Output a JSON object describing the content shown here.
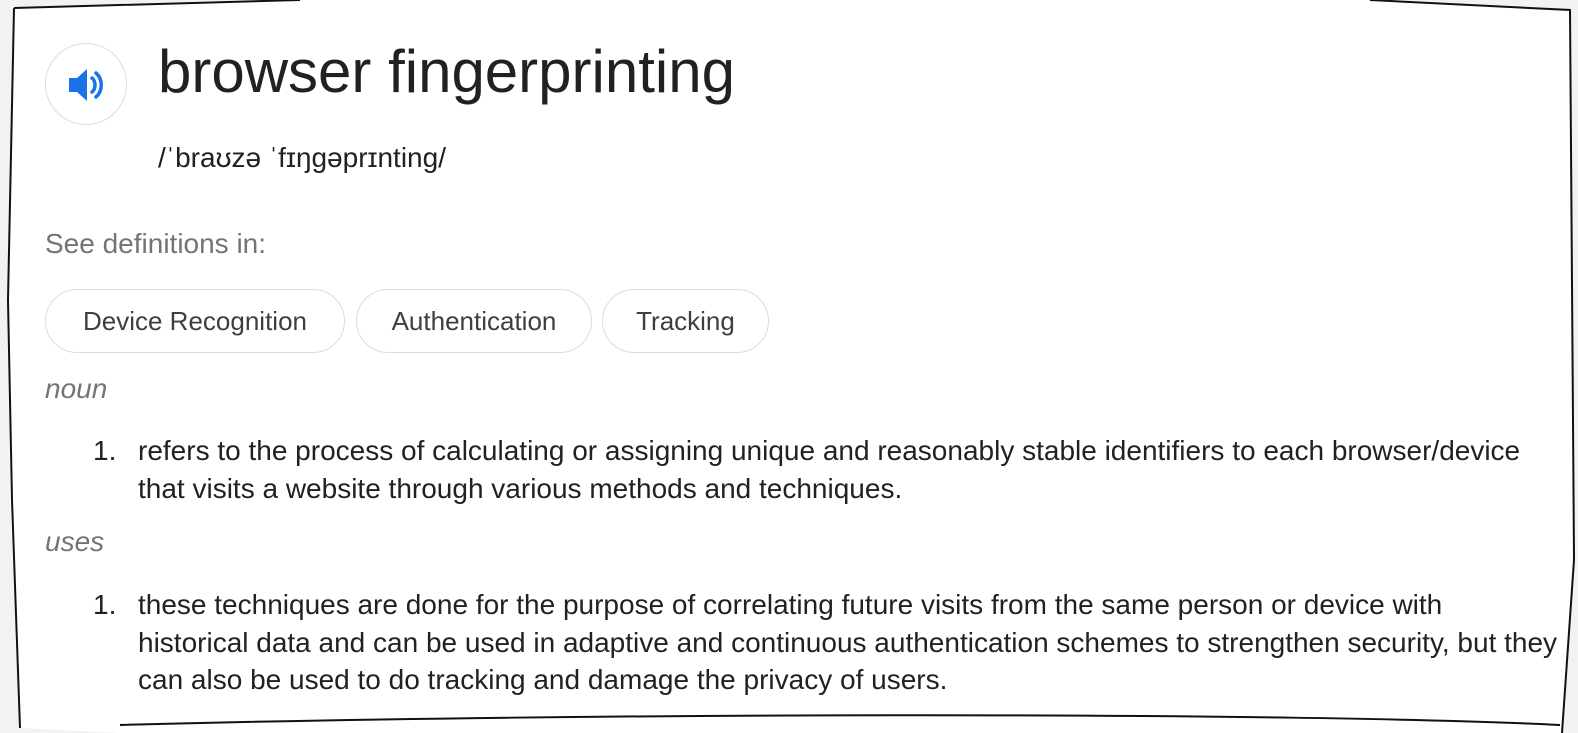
{
  "entry": {
    "term": "browser fingerprinting",
    "pronunciation": "/ˈbraʊzə ˈfɪŋɡəprɪnting/",
    "audio_icon": "speaker-icon",
    "see_definitions_label": "See definitions in:",
    "chips": [
      {
        "label": "Device Recognition"
      },
      {
        "label": "Authentication"
      },
      {
        "label": "Tracking"
      }
    ],
    "senses": [
      {
        "part_of_speech": "noun",
        "definitions": [
          {
            "number": "1.",
            "text": "refers to the process of calculating or assigning unique and reasonably stable identifiers to each browser/device that visits a website through various methods and techniques."
          }
        ]
      },
      {
        "part_of_speech": "uses",
        "definitions": [
          {
            "number": "1.",
            "text": "these techniques are done for the purpose of correlating future visits from the same person or device with historical data and can be used in adaptive and continuous authentication schemes to strengthen security, but they can also be used to do tracking and damage the privacy of users."
          }
        ]
      }
    ]
  },
  "colors": {
    "accent": "#1a73e8",
    "text_primary": "#202124",
    "text_secondary": "#70757a",
    "chip_border": "#dadce0"
  }
}
